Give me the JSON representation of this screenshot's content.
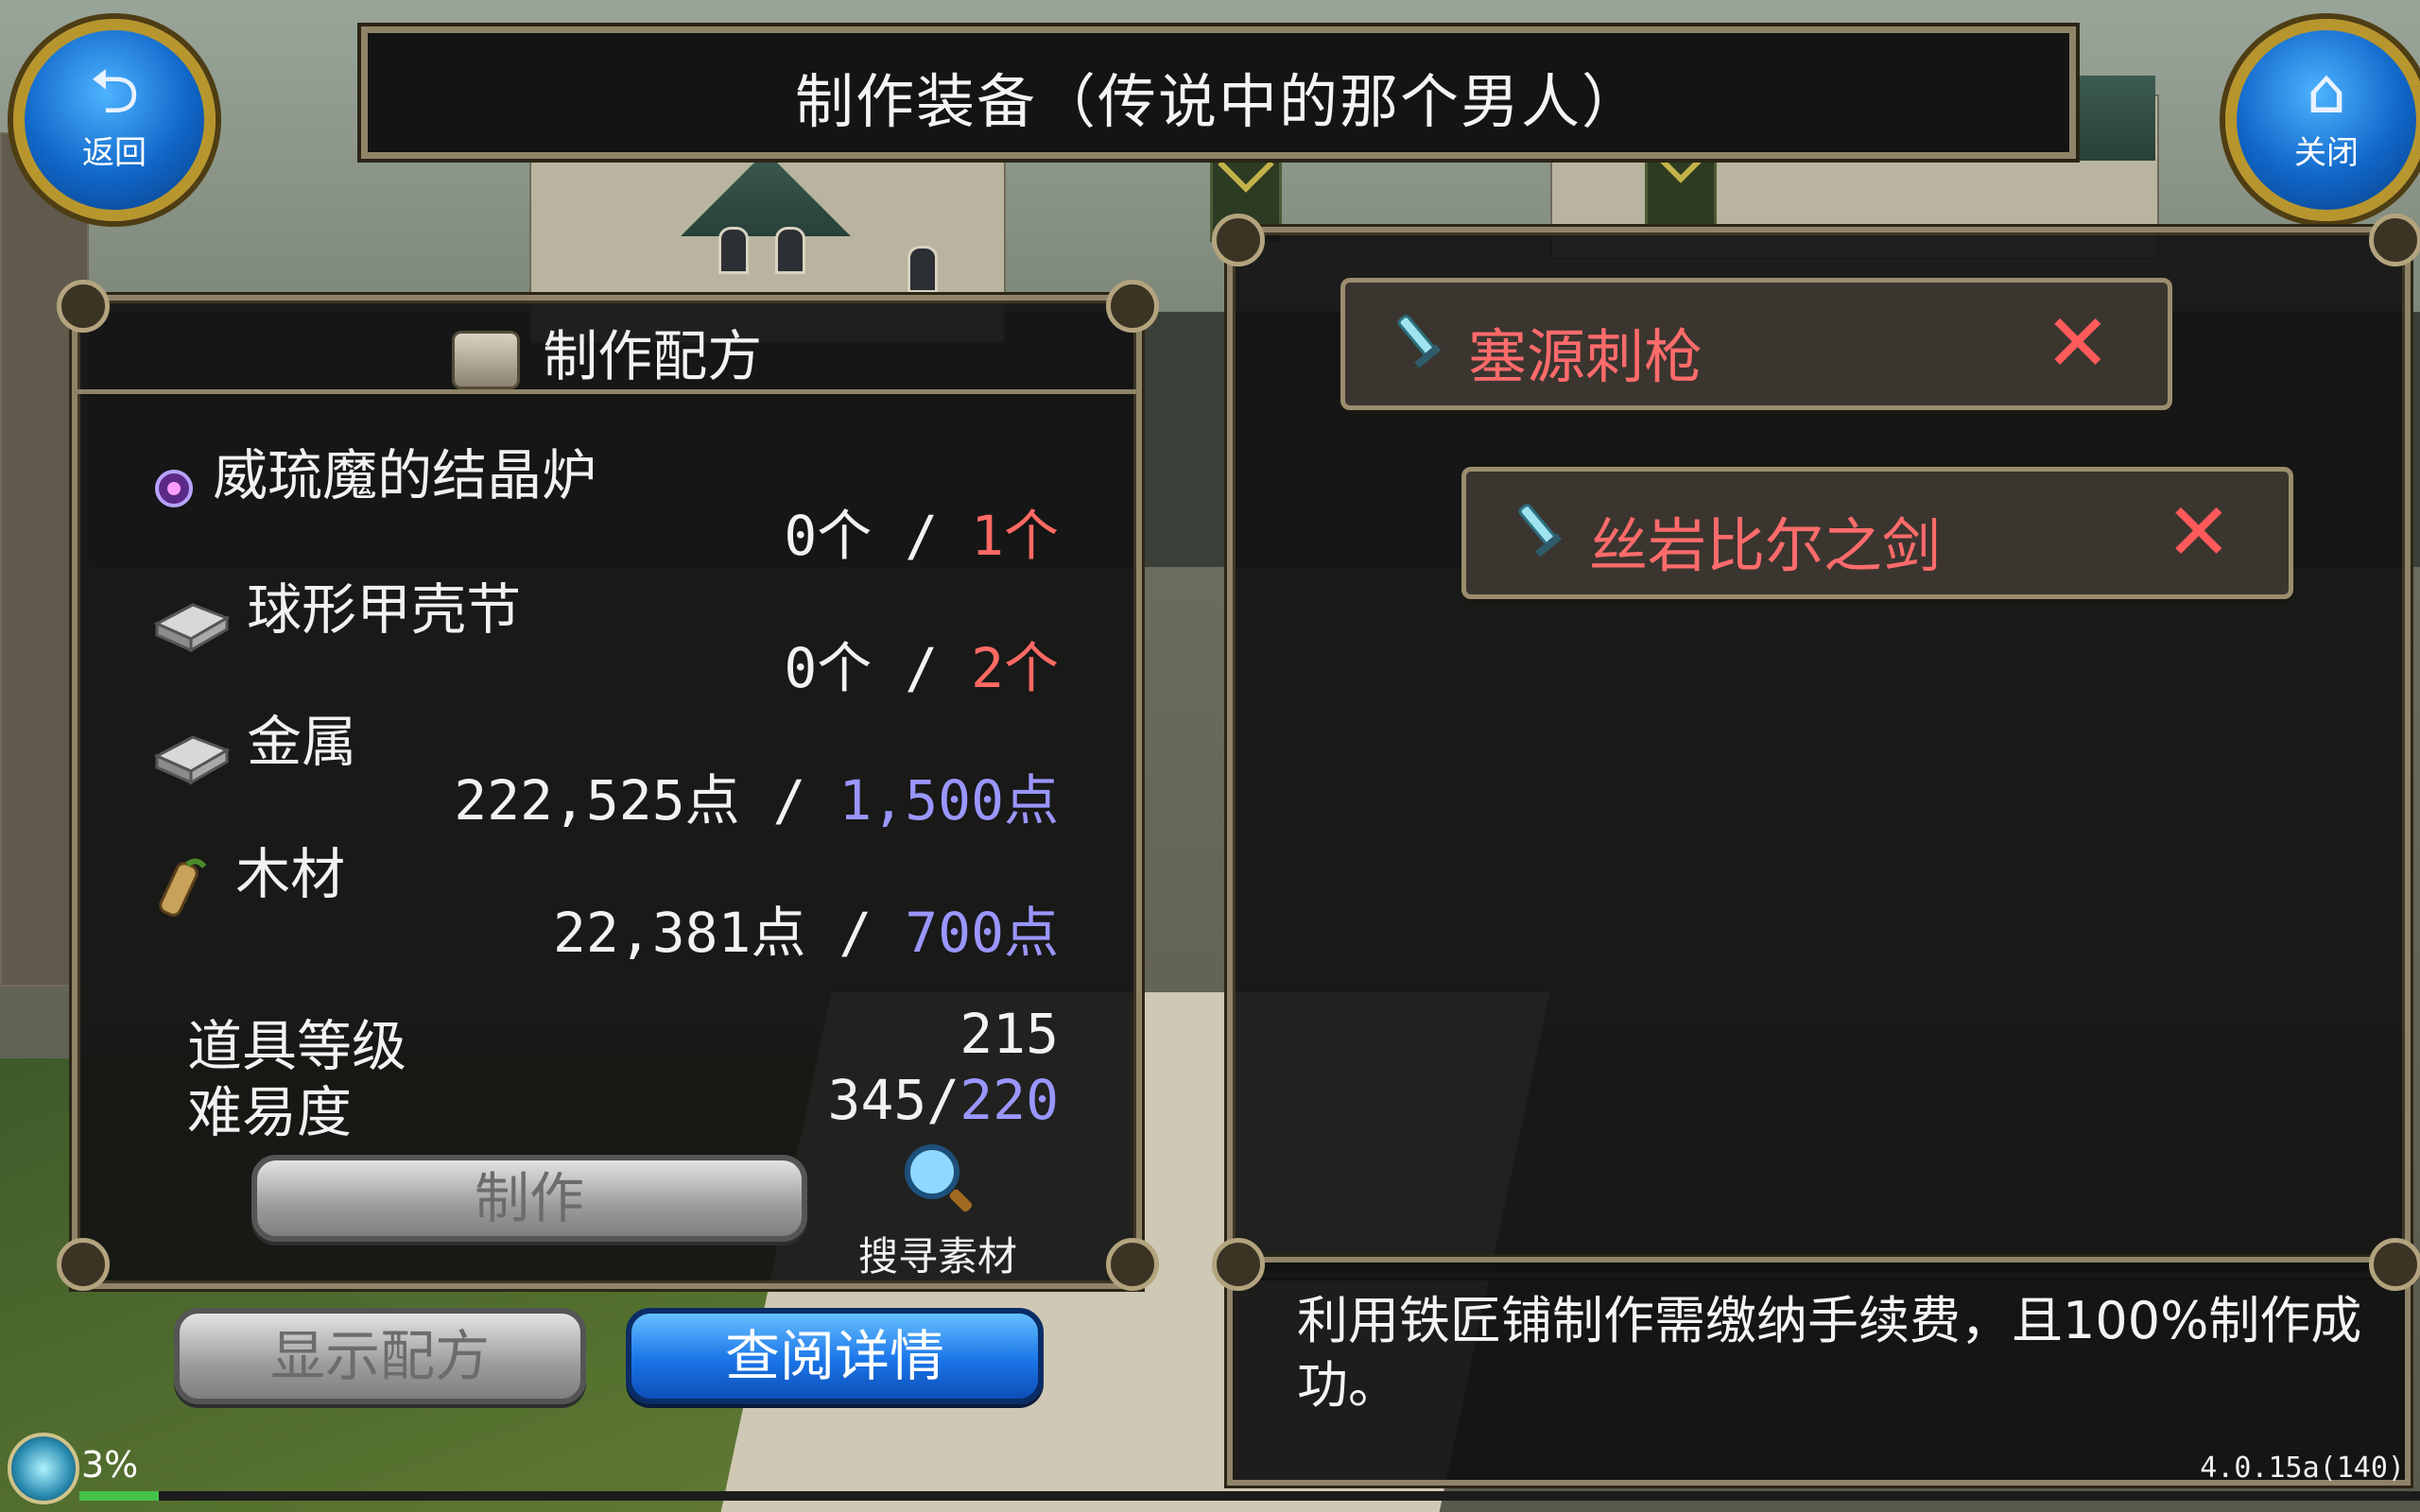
{
  "header": {
    "title": "制作装备（传说中的那个男人）",
    "back_label": "返回",
    "close_label": "关闭"
  },
  "recipe": {
    "heading": "制作配方",
    "materials": [
      {
        "name": "威琉魔的结晶炉",
        "have": "0个",
        "sep": " / ",
        "need": "1个",
        "need_color": "#ff6a63",
        "icon": "crystal-orb-icon"
      },
      {
        "name": "球形甲壳节",
        "have": "0个",
        "sep": " / ",
        "need": "2个",
        "need_color": "#ff6a63",
        "icon": "metal-ingot-icon"
      },
      {
        "name": "金属",
        "have": "222,525点",
        "sep": " / ",
        "need": "1,500点",
        "need_color": "#9a96ff",
        "icon": "metal-ingot-icon"
      },
      {
        "name": "木材",
        "have": "22,381点",
        "sep": " / ",
        "need": "700点",
        "need_color": "#9a96ff",
        "icon": "wood-log-icon"
      }
    ],
    "item_level_label": "道具等级",
    "item_level_value": "215",
    "difficulty_label": "难易度",
    "difficulty_have": "345/",
    "difficulty_need": "220",
    "craft_button": "制作",
    "search_label": "搜寻素材"
  },
  "bottom_buttons": {
    "show_recipe": "显示配方",
    "view_details": "查阅详情"
  },
  "selected_items": [
    {
      "name": "塞源刺枪",
      "remove": "✕"
    },
    {
      "name": "丝岩比尔之剑",
      "remove": "✕"
    }
  ],
  "message": "利用铁匠铺制作需缴纳手续费，且100%制作成功。",
  "hud": {
    "percent": "3%",
    "progress_fraction": 0.03,
    "version": "4.0.15a(140)"
  }
}
